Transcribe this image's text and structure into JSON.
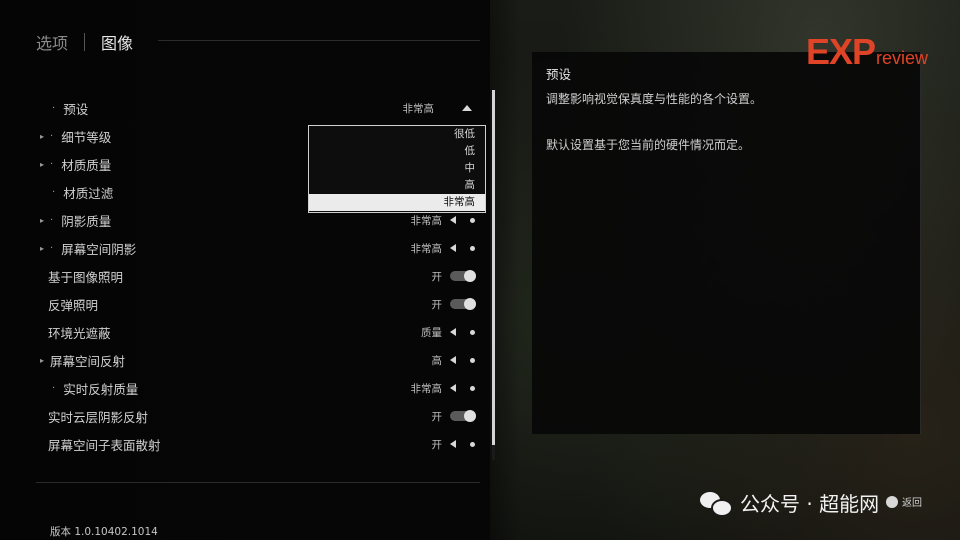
{
  "tabs": [
    "选项",
    "图像"
  ],
  "settings": [
    {
      "label": "预设",
      "value": "非常高",
      "marker": "dot",
      "indent": 1,
      "control": "up"
    },
    {
      "label": "细节等级",
      "value": "",
      "marker": "arrow-dot",
      "indent": 0,
      "control": "none"
    },
    {
      "label": "材质质量",
      "value": "",
      "marker": "arrow-dot",
      "indent": 0,
      "control": "none"
    },
    {
      "label": "材质过滤",
      "value": "",
      "marker": "dot",
      "indent": 1,
      "control": "none"
    },
    {
      "label": "阴影质量",
      "value": "非常高",
      "marker": "arrow-dot",
      "indent": 0,
      "control": "arrow"
    },
    {
      "label": "屏幕空间阴影",
      "value": "非常高",
      "marker": "arrow-dot",
      "indent": 0,
      "control": "arrow"
    },
    {
      "label": "基于图像照明",
      "value": "开",
      "marker": "none",
      "indent": 0,
      "control": "toggle"
    },
    {
      "label": "反弹照明",
      "value": "开",
      "marker": "none",
      "indent": 0,
      "control": "toggle"
    },
    {
      "label": "环境光遮蔽",
      "value": "质量",
      "marker": "none",
      "indent": 0,
      "control": "arrow"
    },
    {
      "label": "屏幕空间反射",
      "value": "高",
      "marker": "arrow",
      "indent": 0,
      "control": "arrow"
    },
    {
      "label": "实时反射质量",
      "value": "非常高",
      "marker": "dot",
      "indent": 1,
      "control": "arrow"
    },
    {
      "label": "实时云层阴影反射",
      "value": "开",
      "marker": "none",
      "indent": 0,
      "control": "toggle"
    },
    {
      "label": "屏幕空间子表面散射",
      "value": "开",
      "marker": "none",
      "indent": 0,
      "control": "arrow"
    }
  ],
  "dropdown": {
    "options": [
      "很低",
      "低",
      "中",
      "高",
      "非常高"
    ],
    "selected": "非常高"
  },
  "version": "版本 1.0.10402.1014",
  "description": {
    "title": "预设",
    "line1": "调整影响视觉保真度与性能的各个设置。",
    "line2": "默认设置基于您当前的硬件情况而定。"
  },
  "logo": {
    "main": "EXP",
    "sub": "review"
  },
  "watermark": "公众号 · 超能网",
  "back_label": "返回",
  "colors": {
    "accent": "#e04427",
    "dropdown_selected_bg": "#ebebeb"
  }
}
